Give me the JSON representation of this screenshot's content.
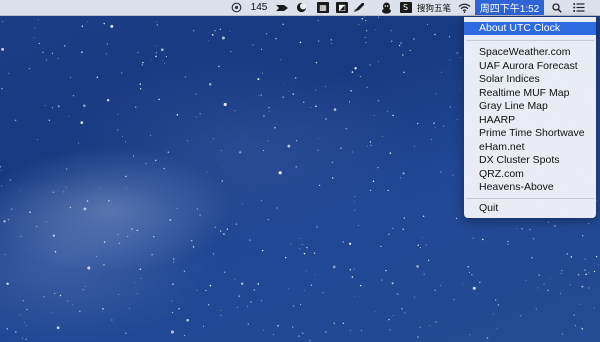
{
  "menubar": {
    "count_label": "145",
    "app_s_label": "S",
    "input_method_label": "搜狗五笔",
    "clock_label": "周四下午1:52",
    "icons": [
      "settings-circle-icon",
      "right-arrow-icon",
      "moon-icon",
      "calendar-icon",
      "image-icon",
      "rocket-icon",
      "qq-penguin-icon",
      "sogou-s-icon",
      "wifi-icon",
      "spotlight-icon",
      "list-icon"
    ]
  },
  "menu": {
    "about": "About UTC Clock",
    "links": [
      "SpaceWeather.com",
      "UAF Aurora Forecast",
      "Solar Indices",
      "Realtime MUF Map",
      "Gray Line Map",
      "HAARP",
      "Prime Time Shortwave",
      "eHam.net",
      "DX Cluster Spots",
      "QRZ.com",
      "Heavens-Above"
    ],
    "quit": "Quit"
  },
  "colors": {
    "highlight": "#2e6be0",
    "menubar_bg": "#eceef4",
    "sky": "#1c3d87"
  }
}
